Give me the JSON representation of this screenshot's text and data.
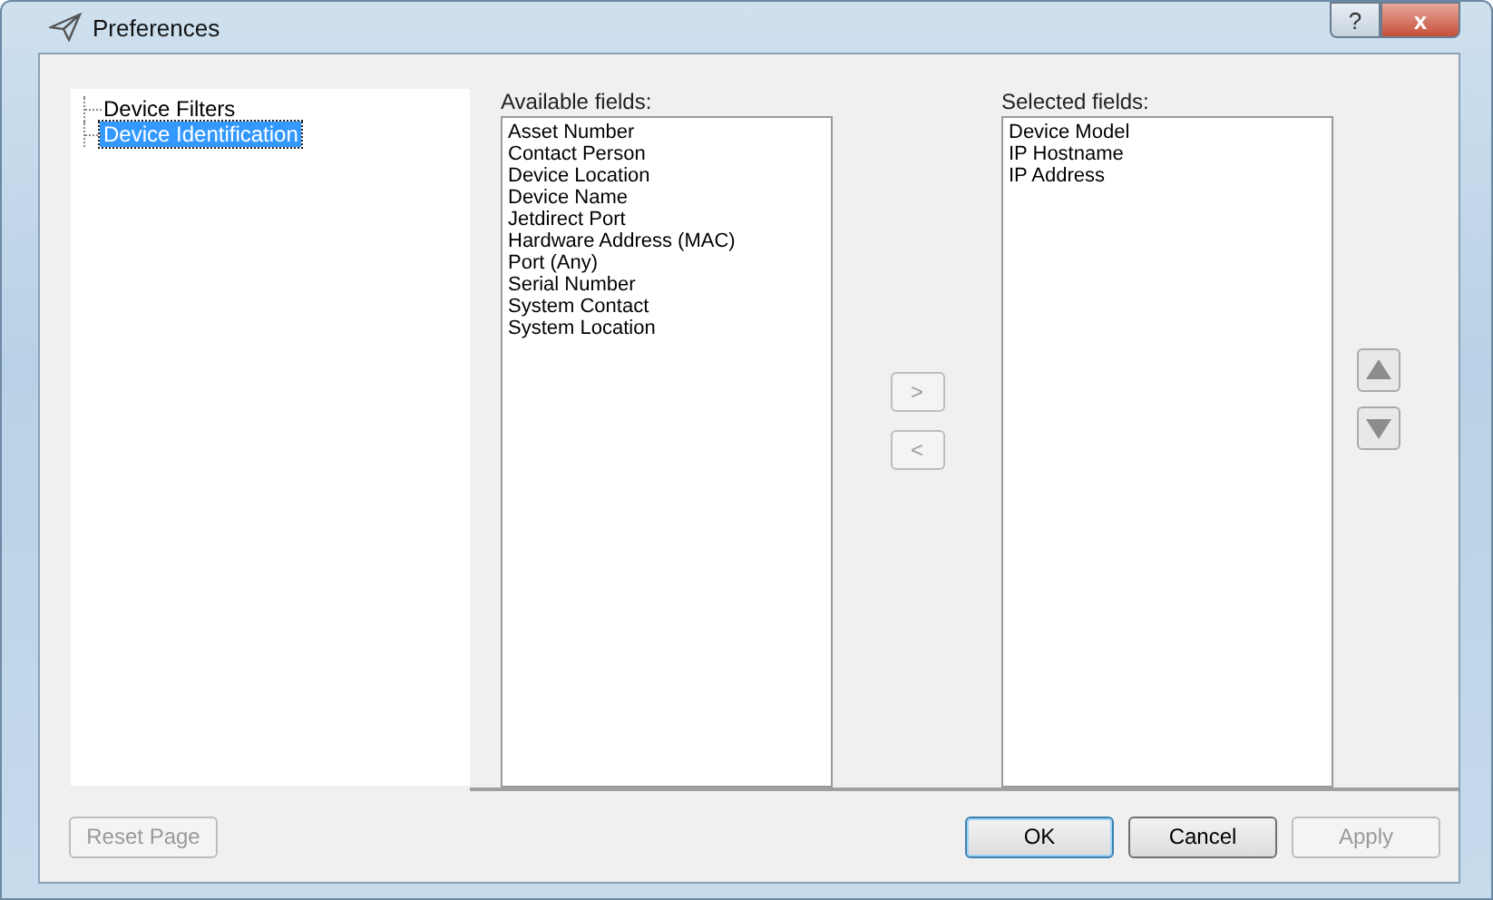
{
  "window": {
    "title": "Preferences",
    "help_button": "?",
    "close_button": "x"
  },
  "tree": [
    {
      "label": "Device Filters",
      "selected": false
    },
    {
      "label": "Device Identification",
      "selected": true
    }
  ],
  "available": {
    "label": "Available fields:",
    "items": [
      "Asset Number",
      "Contact Person",
      "Device Location",
      "Device Name",
      "Jetdirect Port",
      "Hardware Address (MAC)",
      "Port (Any)",
      "Serial Number",
      "System Contact",
      "System Location"
    ]
  },
  "move_buttons": [
    {
      "label": ">",
      "disabled": true
    },
    {
      "label": "<",
      "disabled": true
    }
  ],
  "selected": {
    "label": "Selected fields:",
    "items": [
      "Device Model",
      "IP Hostname",
      "IP Address"
    ]
  },
  "order_buttons": [
    {
      "kind": "up",
      "disabled": true
    },
    {
      "kind": "down",
      "disabled": true
    }
  ],
  "buttons": [
    {
      "label": "Reset Page",
      "disabled": true,
      "default": false
    },
    {
      "label": "OK",
      "disabled": false,
      "default": true
    },
    {
      "label": "Cancel",
      "disabled": false,
      "default": false
    },
    {
      "label": "Apply",
      "disabled": true,
      "default": false
    }
  ]
}
